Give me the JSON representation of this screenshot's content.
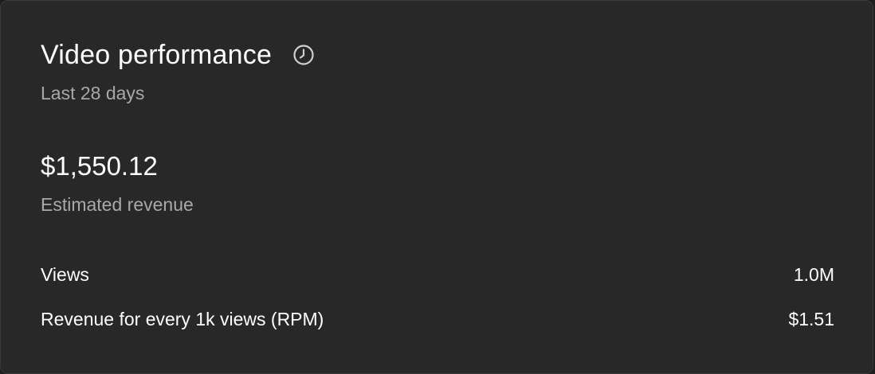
{
  "card": {
    "title": "Video performance",
    "subtitle": "Last 28 days",
    "clock_icon": "clock-icon"
  },
  "primary_metric": {
    "value": "$1,550.12",
    "label": "Estimated revenue"
  },
  "rows": [
    {
      "label": "Views",
      "value": "1.0M"
    },
    {
      "label": "Revenue for every 1k views (RPM)",
      "value": "$1.51"
    }
  ],
  "colors": {
    "card_background": "#282828",
    "primary_text": "#ffffff",
    "secondary_text": "#a8a8a8"
  }
}
